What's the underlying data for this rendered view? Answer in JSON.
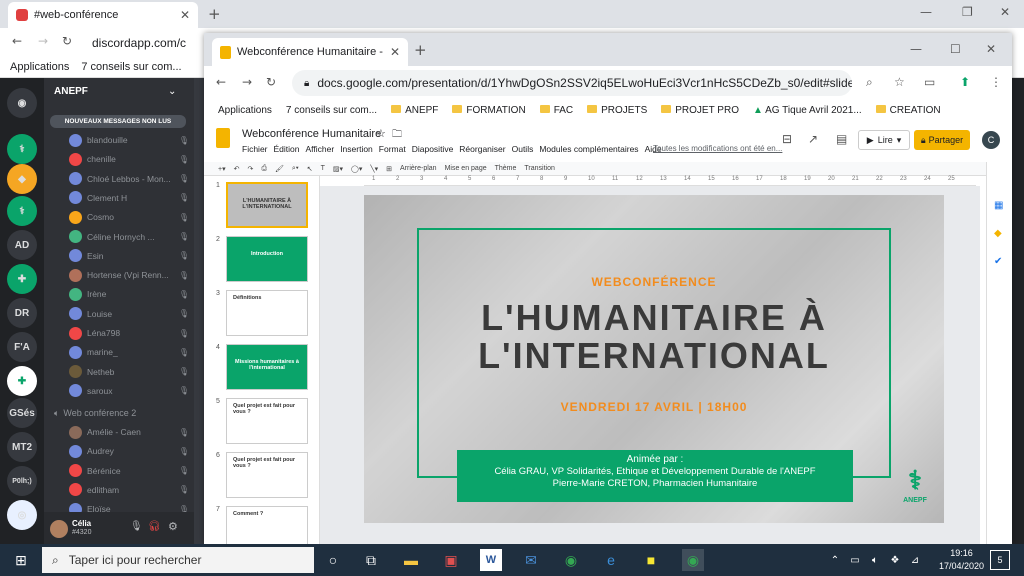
{
  "back_window": {
    "tab_title": "#web-conférence",
    "url": "discordapp.com/c",
    "bookmarks": [
      "Applications",
      "7 conseils sur com..."
    ]
  },
  "discord": {
    "server_name": "ANEPF",
    "servers": [
      "AD",
      "DR",
      "F'A",
      "GSés",
      "MT2",
      "P0lh;)"
    ],
    "unread_banner": "NOUVEAUX MESSAGES NON LUS",
    "members": [
      {
        "name": "blandouille",
        "color": "#7289da"
      },
      {
        "name": "chenille",
        "color": "#f04747"
      },
      {
        "name": "Chloé Lebbos - Mon...",
        "color": "#7289da"
      },
      {
        "name": "Clement H",
        "color": "#7289da"
      },
      {
        "name": "Cosmo",
        "color": "#faa61a"
      },
      {
        "name": "Céline Hornych ...",
        "color": "#43b581"
      },
      {
        "name": "Esin",
        "color": "#7289da"
      },
      {
        "name": "Hortense (Vpi Renn...",
        "color": "#b0705a"
      },
      {
        "name": "Irène",
        "color": "#43b581"
      },
      {
        "name": "Louise",
        "color": "#7289da"
      },
      {
        "name": "Léna798",
        "color": "#f04747"
      },
      {
        "name": "marine_",
        "color": "#7289da"
      },
      {
        "name": "Netheb",
        "color": "#6b5a3a"
      },
      {
        "name": "saroux",
        "color": "#7289da"
      }
    ],
    "voice_channel": "Web conférence 2",
    "members2": [
      {
        "name": "Amélie - Caen",
        "color": "#8a6a5a"
      },
      {
        "name": "Audrey",
        "color": "#7289da"
      },
      {
        "name": "Bérénice",
        "color": "#f04747"
      },
      {
        "name": "edlitham",
        "color": "#f04747"
      },
      {
        "name": "Eloïse",
        "color": "#7289da"
      }
    ],
    "user": {
      "name": "Célia",
      "tag": "#4320"
    }
  },
  "front_window": {
    "tab_title": "Webconférence Humanitaire - Go",
    "url": "docs.google.com/presentation/d/1YhwDgOSn2SSV2iq5ELwoHuEci3Vcr1nHcS5CDeZb_s0/edit#slide=id.g52...",
    "bookmarks": [
      "Applications",
      "7 conseils sur com...",
      "ANEPF",
      "FORMATION",
      "FAC",
      "PROJETS",
      "PROJET PRO",
      "AG Tique Avril 2021...",
      "CREATION"
    ]
  },
  "slides": {
    "doc_title": "Webconférence Humanitaire",
    "menu": [
      "Fichier",
      "Édition",
      "Afficher",
      "Insertion",
      "Format",
      "Diapositive",
      "Réorganiser",
      "Outils",
      "Modules complémentaires",
      "Aide"
    ],
    "save_status": "Toutes les modifications ont été en...",
    "present_label": "Lire",
    "share_label": "Partager",
    "avatar_letter": "C",
    "toolbar": [
      "Arrière-plan",
      "Mise en page",
      "Thème",
      "Transition"
    ],
    "thumbnails": [
      {
        "num": "1",
        "label": "L'HUMANITAIRE À L'INTERNATIONAL",
        "style": "photo"
      },
      {
        "num": "2",
        "label": "Introduction",
        "style": "green"
      },
      {
        "num": "3",
        "label": "Définitions",
        "style": "white"
      },
      {
        "num": "4",
        "label": "Missions humanitaires à l'international",
        "style": "green"
      },
      {
        "num": "5",
        "label": "Quel projet est fait pour vous ?",
        "style": "white"
      },
      {
        "num": "6",
        "label": "Quel projet est fait pour vous ?",
        "style": "white"
      },
      {
        "num": "7",
        "label": "Comment ?",
        "style": "white"
      }
    ],
    "ruler": [
      "1",
      "2",
      "3",
      "4",
      "5",
      "6",
      "7",
      "8",
      "9",
      "10",
      "11",
      "12",
      "13",
      "14",
      "15",
      "16",
      "17",
      "18",
      "19",
      "20",
      "21",
      "22",
      "23",
      "24",
      "25"
    ],
    "slide": {
      "kicker": "WEBCONFÉRENCE",
      "title_line1": "L'HUMANITAIRE À",
      "title_line2": "L'INTERNATIONAL",
      "date": "VENDREDI 17 AVRIL | 18H00",
      "box_line1": "Animée par :",
      "box_line2": "Célia GRAU, VP Solidarités, Ethique et Développement Durable de l'ANEPF",
      "box_line3": "Pierre-Marie CRETON, Pharmacien Humanitaire",
      "logo_text": "ANEPF"
    }
  },
  "taskbar": {
    "search_placeholder": "Taper ici pour rechercher",
    "time": "19:16",
    "date": "17/04/2020",
    "notifications": "5"
  }
}
